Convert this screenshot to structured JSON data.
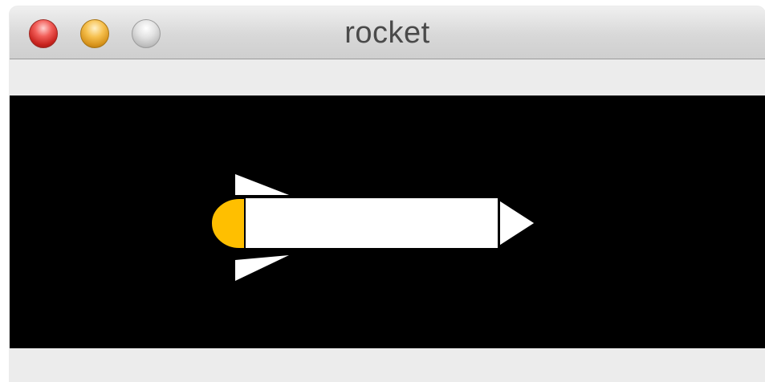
{
  "window": {
    "title": "rocket"
  },
  "controls": {
    "close": "close-icon",
    "minimize": "minimize-icon",
    "zoom": "zoom-icon"
  },
  "canvas": {
    "background": "#000000"
  },
  "rocket": {
    "body_color": "#ffffff",
    "outline_color": "#000000",
    "flame_color": "#ffbf00"
  }
}
